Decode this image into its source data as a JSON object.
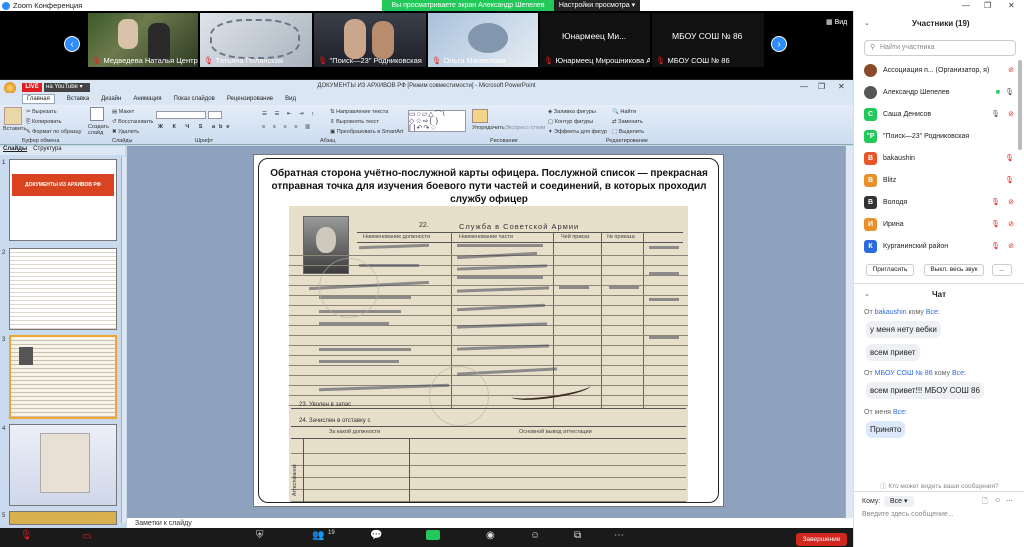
{
  "zoom": {
    "window_title": "Zoom Конференция",
    "share_notice": "Вы просматриваете экран Александр Шепелев",
    "view_settings": "Настройки просмотра",
    "view_label": "Вид",
    "videos": [
      {
        "name": "Медведева Наталья Центр д..."
      },
      {
        "name": "Татьяна Полянская"
      },
      {
        "name": "\"Поиск—23\" Родниковская"
      },
      {
        "name": "Ольга Манвелова"
      },
      {
        "name": "Юнармеец Мирошникова А...",
        "tile_text": "Юнармеец  Ми..."
      },
      {
        "name": "МБОУ СОШ № 86",
        "tile_text": "МБОУ СОШ № 86"
      }
    ],
    "leave_button": "Завершение",
    "bottom_count": "19"
  },
  "stream": {
    "live": "LIVE",
    "platform": "на YouTube"
  },
  "ppt": {
    "title": "ДОКУМЕНТЫ ИЗ АРХИВОВ РФ [Режим совместимости] - Microsoft PowerPoint",
    "tabs": [
      "Главная",
      "Вставка",
      "Дизайн",
      "Анимация",
      "Показ слайдов",
      "Рецензирование",
      "Вид"
    ],
    "ribbon": {
      "paste": "Вставить",
      "cut": "Вырезать",
      "copy": "Копировать",
      "format": "Формат по образцу",
      "clipboard": "Буфер обмена",
      "new_slide": "Создать слайд",
      "layout": "Макет",
      "reset": "Восстановить",
      "delete": "Удалить",
      "slides_group": "Слайды",
      "font_group": "Шрифт",
      "paragraph_group": "Абзац",
      "text_direction": "Направление текста",
      "align_text": "Выровнять текст",
      "smartart": "Преобразовать в SmartArt",
      "arrange": "Упорядочить",
      "quick_styles": "Экспресс-стили",
      "shape_fill": "Заливка фигуры",
      "shape_outline": "Контур фигуры",
      "shape_effects": "Эффекты для фигур",
      "drawing_group": "Рисование",
      "find": "Найти",
      "replace": "Заменить",
      "select": "Выделить",
      "editing_group": "Редактирование"
    },
    "side_tabs": [
      "Слайды",
      "Структура"
    ],
    "slide1_title": "ДОКУМЕНТЫ ИЗ АРХИВОВ РФ",
    "slide_title": "Обратная сторона учётно-послужной карты офицера. Послужной список — прекрасная отправная точка для изучения боевого пути частей и соединений, в которых проходил службу офицер",
    "doc": {
      "header_num": "22.",
      "header": "Служба в Советской Армии",
      "col1": "Наименование должности",
      "col2": "Наименование части",
      "col3": "Чей приказ",
      "col4": "№ приказа",
      "row23": "23. Уволен в запас",
      "row24": "24. Зачислен в отставку с",
      "attest": "Аттестование",
      "attest_col1": "За какой должности",
      "attest_col2": "Основной вывод аттестации"
    },
    "notes": "Заметки к слайду"
  },
  "participants": {
    "header": "Участники (19)",
    "search_placeholder": "Найти участника",
    "list": [
      {
        "name": "Ассоциация п... (Организатор, я)",
        "avatar": "",
        "color": "#8a4b2b"
      },
      {
        "name": "Александр Шепелев",
        "avatar": "",
        "color": "#555"
      },
      {
        "name": "Саша Денисов",
        "avatar": "С",
        "color": "#23c85a"
      },
      {
        "name": "\"Поиск—23\" Родниковская",
        "avatar": "\"Р",
        "color": "#23c85a"
      },
      {
        "name": "bakaushin",
        "avatar": "B",
        "color": "#e8562a"
      },
      {
        "name": "Blitz",
        "avatar": "B",
        "color": "#e8902a"
      },
      {
        "name": "Володя",
        "avatar": "В",
        "color": "#333"
      },
      {
        "name": "Ирина",
        "avatar": "И",
        "color": "#e8902a"
      },
      {
        "name": "Курганинский район",
        "avatar": "К",
        "color": "#2d6cdf"
      }
    ],
    "invite": "Пригласить",
    "mute_all": "Выкл. весь звук",
    "more": "..."
  },
  "chat": {
    "header": "Чат",
    "messages": [
      {
        "from": "bakaushin",
        "to": "Все",
        "text": "у меня нету вебки"
      },
      {
        "from": "",
        "to": "",
        "text": "всем привет"
      },
      {
        "from": "МБОУ СОШ № 86",
        "to": "Все",
        "text": "всем привет!!! МБОУ СОШ 86"
      },
      {
        "from": "меня",
        "to": "Все",
        "text": "Принято"
      }
    ],
    "from_word": "От",
    "to_word": "кому",
    "who_sees": "Кто может видеть ваши сообщения?",
    "to_label": "Кому:",
    "to_value": "Все",
    "input_placeholder": "Введите здесь сообщение..."
  },
  "colors": {
    "zoom_blue": "#2d8cff",
    "share_green": "#23c85a",
    "red": "#e02020",
    "leave": "#d0281f"
  }
}
